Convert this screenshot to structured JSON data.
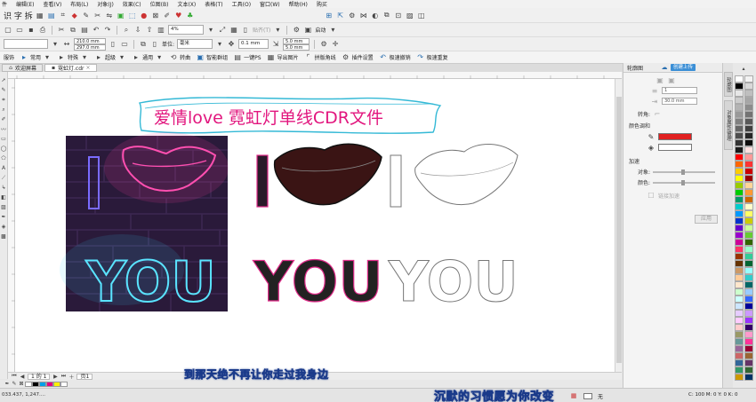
{
  "menu": [
    "编辑(E)",
    "查看(V)",
    "布局(L)",
    "对象(J)",
    "效果(C)",
    "位图(B)",
    "文本(X)",
    "表格(T)",
    "工具(O)",
    "窗口(W)",
    "帮助(H)",
    "购买"
  ],
  "menu_prefix": "件",
  "toolbar1": {
    "text_tools": "识 字 拆",
    "zoom_value": "4%",
    "snap_label": "贴齐(T)",
    "launch_label": "启动"
  },
  "toolbar2": {
    "width": "210.0 mm",
    "height": "297.0 mm",
    "unit_label": "单位:",
    "unit_value": "毫米",
    "nudge": "0.1 mm",
    "dup_x": "5.0 mm",
    "dup_y": "5.0 mm"
  },
  "pluginbar": {
    "items": [
      "服饰",
      "常用",
      "特殊",
      "超级",
      "通用",
      "转曲",
      "智能群组",
      "一键PS",
      "导出图片",
      "拼版角线",
      "插件设置",
      "极速撤销",
      "极速重复"
    ]
  },
  "tabs": {
    "welcome": "欢迎屏幕",
    "doc": "霓虹灯.cdr"
  },
  "canvas": {
    "banner_text": "爱情love 霓虹灯单线CDR文件",
    "artwork_i": "I",
    "artwork_you": "YOU"
  },
  "pagebar": {
    "page_counter": "1 的 1",
    "page_tab": "页1"
  },
  "status": {
    "coords": "033.437, 1,247....",
    "fill_label": "无",
    "cmyk": "C: 100 M: 0 Y: 0 K: 0"
  },
  "subtitles": {
    "line1": "到那天绝不再让你走过我身边",
    "line2": "沉默的习惯愿为你改变"
  },
  "dock": {
    "title": "轮廓图",
    "active_button": "创建上传",
    "offset_value": "1",
    "distance_value": "30.0 mm",
    "angle_label": "转角:",
    "color_section": "颜色调和",
    "outline_color": "#e02020",
    "fill_color": "#ffffff",
    "accel_section": "加速",
    "obj_label": "对象:",
    "color_label": "颜色:",
    "link_label": "链接加速",
    "apply_label": "应用"
  },
  "side_tabs": [
    "轮廓图",
    "对象属性/管理"
  ],
  "palette": {
    "col1": [
      "#ffffff",
      "#000000",
      "#e6e6e6",
      "#cccccc",
      "#b3b3b3",
      "#999999",
      "#808080",
      "#666666",
      "#4d4d4d",
      "#333333",
      "#1a1a1a",
      "#ff0000",
      "#ff6600",
      "#ffcc00",
      "#ffff00",
      "#99cc00",
      "#00cc00",
      "#009966",
      "#00cccc",
      "#0099ff",
      "#0033cc",
      "#6600cc",
      "#9900cc",
      "#cc0099",
      "#ff3366",
      "#993300",
      "#663300",
      "#cc9966",
      "#ffcc99",
      "#ffe6cc",
      "#ccffcc",
      "#ccffff",
      "#cce6ff",
      "#e6ccff",
      "#ffccff",
      "#ffcccc",
      "#999966",
      "#669999",
      "#996699",
      "#cc6666",
      "#336699",
      "#339966",
      "#cc9900"
    ],
    "col2": [
      "#f2f2f2",
      "#d9d9d9",
      "#bfbfbf",
      "#a6a6a6",
      "#8c8c8c",
      "#737373",
      "#595959",
      "#404040",
      "#262626",
      "#0d0d0d",
      "#ffe0e0",
      "#ff9999",
      "#ff3333",
      "#cc0000",
      "#990000",
      "#ffd699",
      "#ff9933",
      "#cc6600",
      "#ffffcc",
      "#ffff66",
      "#cccc00",
      "#ccff99",
      "#66cc33",
      "#336600",
      "#99ffcc",
      "#33cc99",
      "#006633",
      "#99ffff",
      "#33cccc",
      "#006666",
      "#99ccff",
      "#3366ff",
      "#000099",
      "#cc99ff",
      "#9933ff",
      "#330066",
      "#ff99cc",
      "#ff3399",
      "#990033",
      "#996633",
      "#663366",
      "#336633",
      "#003366"
    ]
  },
  "colorrow": [
    "#ffffff",
    "#000000",
    "#00a0e9",
    "#e4007f",
    "#fff100",
    "#ffffff"
  ]
}
